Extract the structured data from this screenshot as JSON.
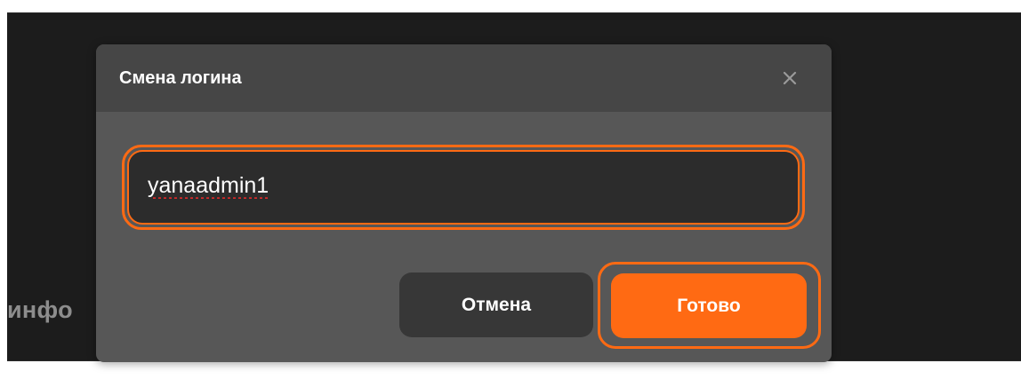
{
  "background": {
    "partial_text": "инфо"
  },
  "dialog": {
    "title": "Смена логина",
    "close_icon": "close-icon",
    "input": {
      "value": "yanaadmin1",
      "placeholder": ""
    },
    "buttons": {
      "cancel_label": "Отмена",
      "done_label": "Готово"
    }
  },
  "colors": {
    "accent": "#ff6a13",
    "dialog_body": "#575757",
    "dialog_header": "#464646",
    "input_background": "#2c2c2c",
    "cancel_button": "#373737",
    "backdrop": "#1c1c1c"
  }
}
